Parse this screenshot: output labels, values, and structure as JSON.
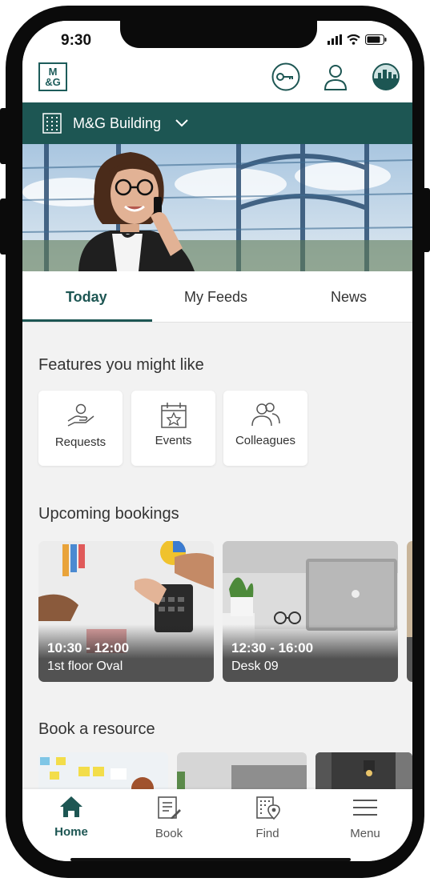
{
  "status": {
    "time": "9:30"
  },
  "app": {
    "logo_text": "M\n&G",
    "logo_line1": "M",
    "logo_line2": "&G"
  },
  "building": {
    "name": "M&G Building"
  },
  "tabs": [
    {
      "label": "Today",
      "active": true
    },
    {
      "label": "My Feeds",
      "active": false
    },
    {
      "label": "News",
      "active": false
    }
  ],
  "features": {
    "title": "Features you might like",
    "items": [
      {
        "label": "Requests",
        "icon": "hand-person-icon"
      },
      {
        "label": "Events",
        "icon": "calendar-star-icon"
      },
      {
        "label": "Colleagues",
        "icon": "people-icon"
      }
    ]
  },
  "bookings": {
    "title": "Upcoming bookings",
    "items": [
      {
        "time": "10:30 - 12:00",
        "place": "1st floor Oval"
      },
      {
        "time": "12:30 - 16:00",
        "place": "Desk 09"
      }
    ]
  },
  "resources": {
    "title": "Book a resource"
  },
  "nav": [
    {
      "label": "Home",
      "icon": "home-icon",
      "active": true
    },
    {
      "label": "Book",
      "icon": "book-icon",
      "active": false
    },
    {
      "label": "Find",
      "icon": "find-building-icon",
      "active": false
    },
    {
      "label": "Menu",
      "icon": "menu-icon",
      "active": false
    }
  ],
  "colors": {
    "brand": "#1d5653",
    "background": "#f2f2f2"
  }
}
